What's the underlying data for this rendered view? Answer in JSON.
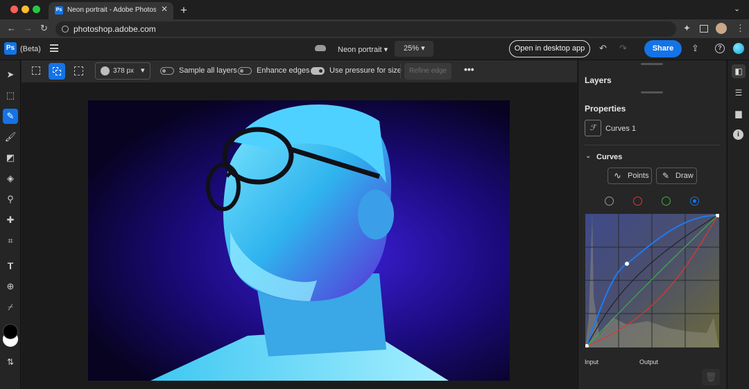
{
  "browser": {
    "tab_title": "Neon portrait - Adobe Photoshop",
    "url": "photoshop.adobe.com"
  },
  "header": {
    "app_label": "(Beta)",
    "doc_name": "Neon portrait",
    "zoom": "25%",
    "open_desktop_label": "Open in desktop app",
    "share_label": "Share"
  },
  "options": {
    "brush_size": "378 px",
    "sample_all_layers": "Sample all layers",
    "enhance_edges": "Enhance edges",
    "use_pressure": "Use pressure for size",
    "refine_edge": "Refine edge"
  },
  "panel": {
    "layers_title": "Layers",
    "properties_title": "Properties",
    "layer_name": "Curves 1",
    "curves_title": "Curves",
    "points_label": "Points",
    "draw_label": "Draw",
    "input_label": "Input",
    "output_label": "Output"
  },
  "colors": {
    "accent": "#1473e6",
    "channel_rgb": "#9a9a9a",
    "channel_red": "#e0382c",
    "channel_green": "#3cb34a",
    "channel_blue": "#1473e6"
  },
  "icons": [
    "move-icon",
    "transform-icon",
    "quick-select-icon",
    "brush-icon",
    "eraser-icon",
    "fill-icon",
    "dodge-icon",
    "healing-icon",
    "crop-icon",
    "type-icon",
    "add-image-icon",
    "eyedropper-icon",
    "swap-icon"
  ]
}
